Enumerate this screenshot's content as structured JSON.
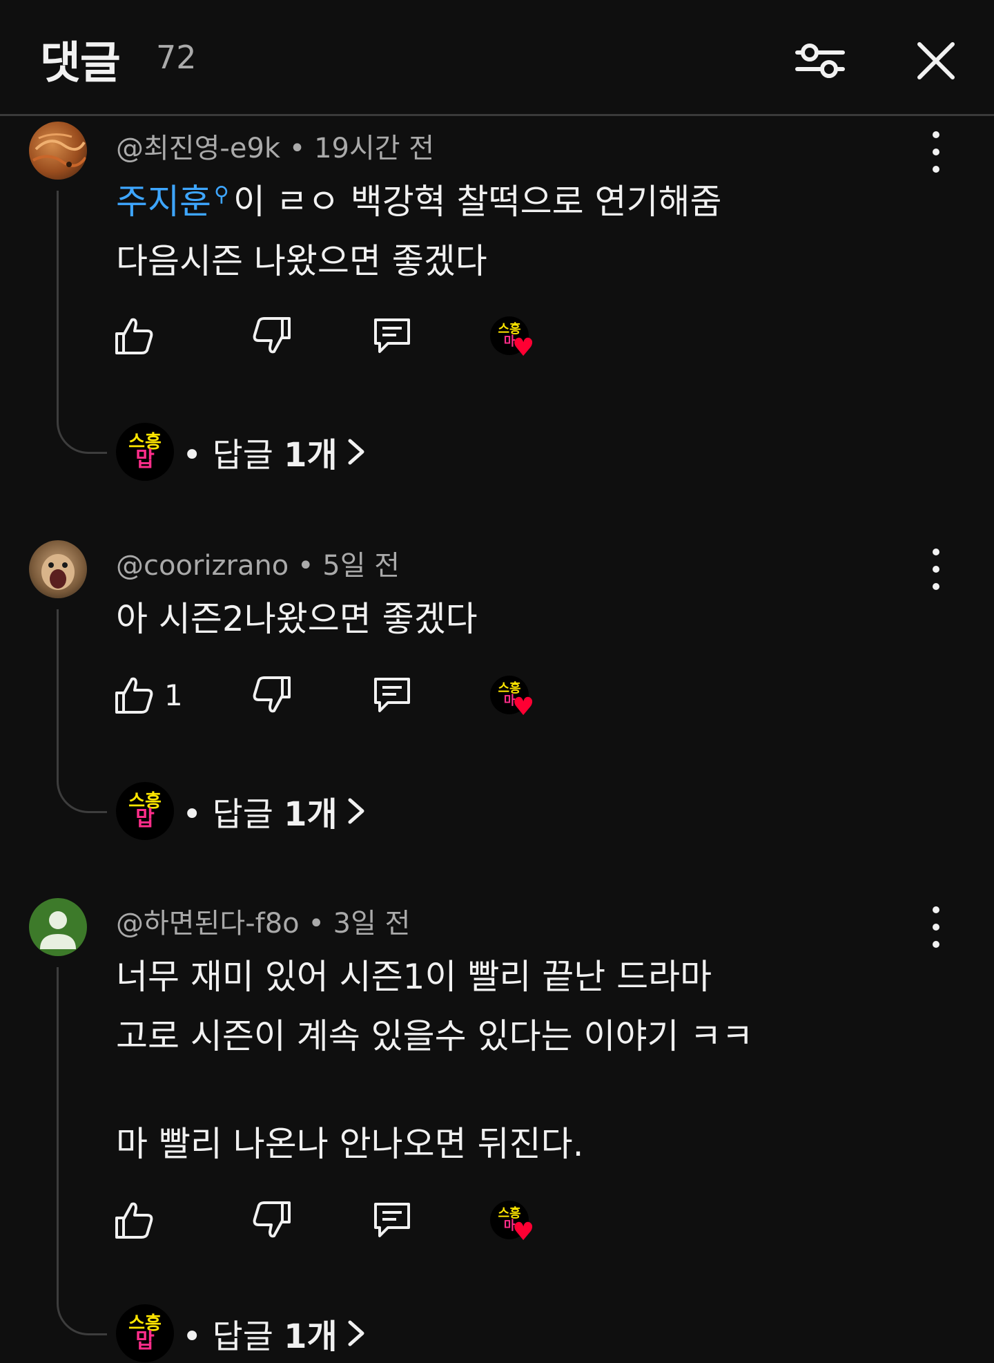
{
  "header": {
    "title": "댓글",
    "count": "72"
  },
  "creator_logo": {
    "top": "스흥",
    "bottom": "맙"
  },
  "mini_logo": {
    "top": "스흥",
    "bottom": "마"
  },
  "comments": [
    {
      "author": "@최진영-e9k",
      "time": "• 19시간 전",
      "mention": "주지훈",
      "lines": [
        "이 ㄹㅇ 백강혁 찰떡으로 연기해줌",
        "다음시즌 나왔으면 좋겠다"
      ],
      "likes": "",
      "replies_prefix": "• 답글 ",
      "replies_count": "1개"
    },
    {
      "author": "@coorizrano",
      "time": "• 5일 전",
      "lines": [
        "아 시즌2나왔으면 좋겠다"
      ],
      "likes": "1",
      "replies_prefix": "• 답글 ",
      "replies_count": "1개"
    },
    {
      "author": "@하면된다-f8o",
      "time": "• 3일 전",
      "lines": [
        "너무 재미 있어 시즌1이 빨리 끝난 드라마",
        "고로 시즌이 계속 있을수 있다는 이야기 ㅋㅋ",
        "",
        "마 빨리 나온나 안나오면 뒤진다."
      ],
      "likes": "",
      "replies_prefix": "• 답글 ",
      "replies_count": "1개"
    }
  ],
  "colors": {
    "background": "#0f0f0f",
    "mention": "#3ea6ff",
    "heart": "#ff0033",
    "secondary_text": "#aaaaaa"
  }
}
